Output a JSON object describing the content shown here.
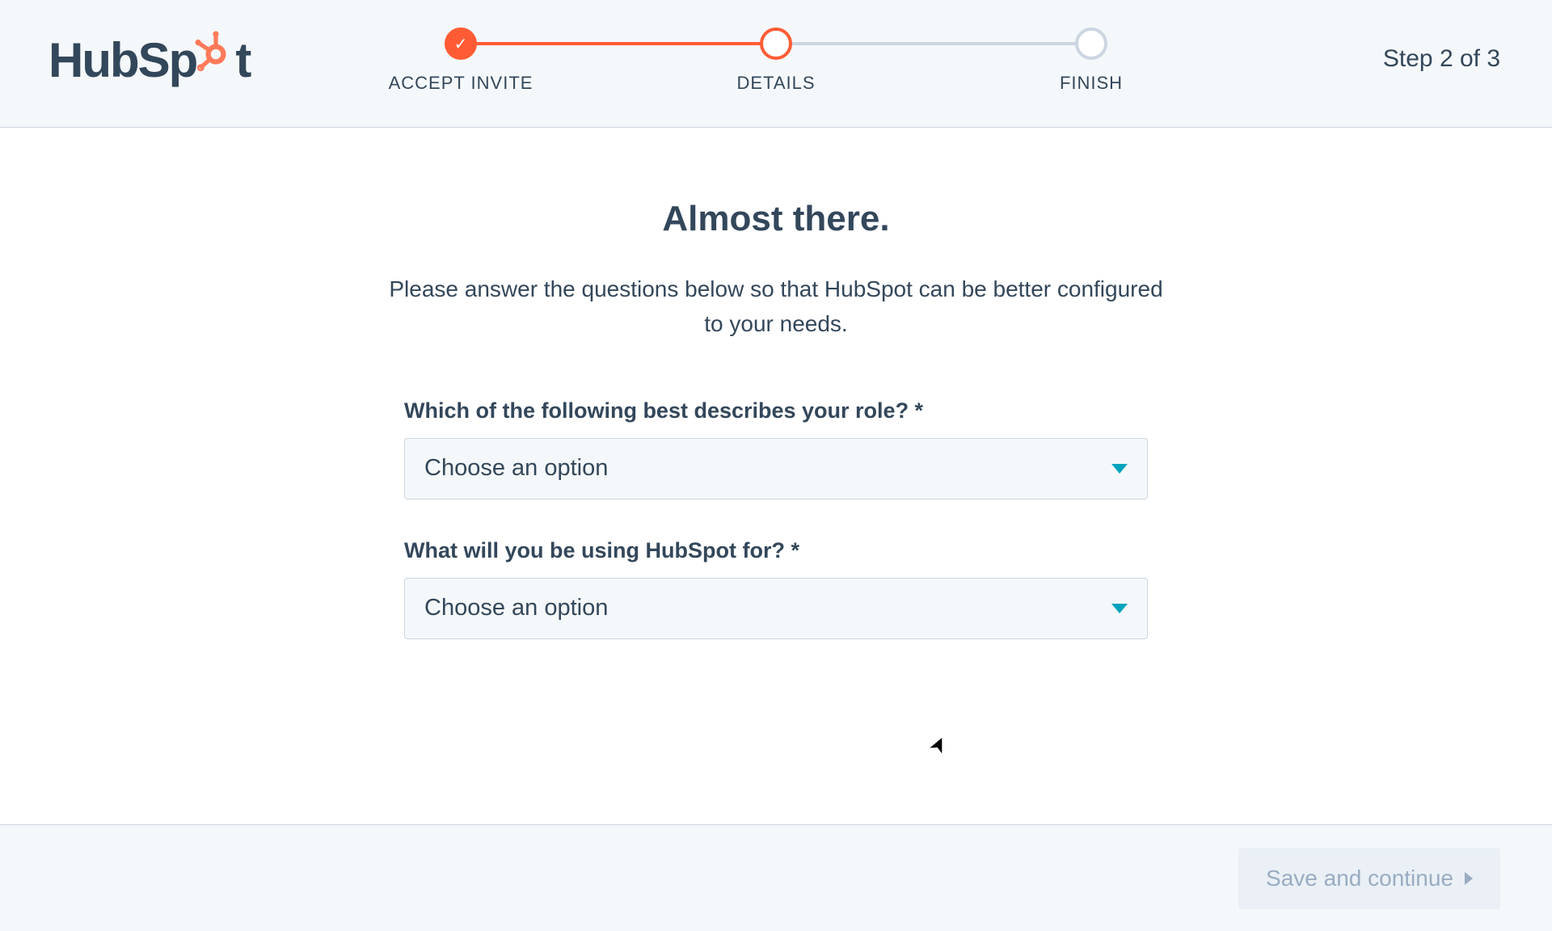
{
  "brand": {
    "name_left": "HubSp",
    "name_right": "t"
  },
  "stepper": {
    "counter": "Step 2 of 3",
    "steps": [
      {
        "label": "ACCEPT INVITE",
        "state": "done"
      },
      {
        "label": "DETAILS",
        "state": "current"
      },
      {
        "label": "FINISH",
        "state": "todo"
      }
    ],
    "fill_percent": 50
  },
  "page": {
    "title": "Almost there.",
    "subtitle": "Please answer the questions below so that HubSpot can be better configured to your needs."
  },
  "form": {
    "fields": [
      {
        "label": "Which of the following best describes your role? *",
        "placeholder": "Choose an option"
      },
      {
        "label": "What will you be using HubSpot for? *",
        "placeholder": "Choose an option"
      }
    ]
  },
  "footer": {
    "save_label": "Save and continue",
    "save_enabled": false
  }
}
